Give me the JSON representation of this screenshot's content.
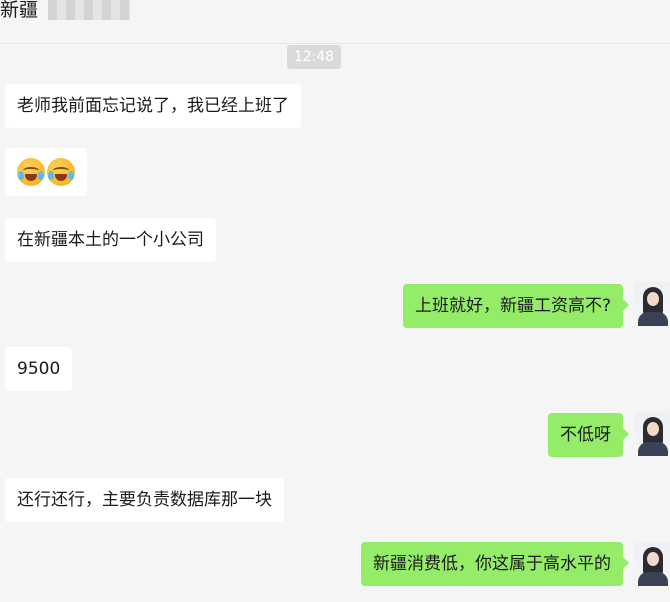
{
  "header": {
    "title": "新疆"
  },
  "timestamp": "12:48",
  "messages": [
    {
      "side": "in",
      "text": "老师我前面忘记说了，我已经上班了"
    },
    {
      "side": "in",
      "emoji": [
        "crying-laughing-emoji",
        "crying-laughing-emoji"
      ]
    },
    {
      "side": "in",
      "text": "在新疆本土的一个小公司"
    },
    {
      "side": "out",
      "text": "上班就好，新疆工资高不?"
    },
    {
      "side": "in",
      "text": "9500"
    },
    {
      "side": "out",
      "text": "不低呀"
    },
    {
      "side": "in",
      "text": "还行还行，主要负责数据库那一块"
    },
    {
      "side": "out",
      "text": "新疆消费低，你这属于高水平的"
    }
  ],
  "colors": {
    "background": "#f5f5f5",
    "incoming_bubble": "#ffffff",
    "outgoing_bubble": "#95ec69",
    "timestamp_bg": "#dadada"
  }
}
